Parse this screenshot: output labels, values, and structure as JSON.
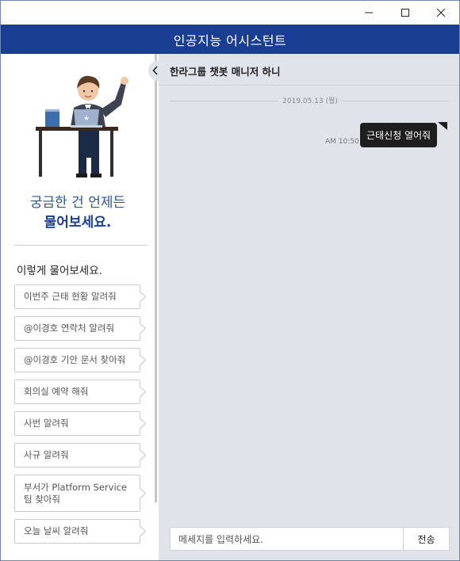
{
  "window": {
    "controls": [
      "minimize-icon",
      "maximize-icon",
      "close-icon"
    ]
  },
  "header": {
    "title": "인공지능 어시스턴트"
  },
  "sidebar": {
    "slogan_line1": "궁금한 건 언제든",
    "slogan_line2": "물어보세요.",
    "guide_title": "이렇게 물어보세요.",
    "suggestions": [
      "이번주 근태 현황 알려줘",
      "@이경호 연락처 알려줘",
      "@이경호 기안 문서 찾아줘",
      "회의실 예약 해줘",
      "사번 알려줘",
      "사규 알려줘",
      "부서가 Platform Service팀 찾아줘",
      "오늘 날씨 알려줘"
    ]
  },
  "chat": {
    "title": "한라그룹 챗봇 매니저 하니",
    "date": "2019.05.13 (월)",
    "messages": [
      {
        "time": "AM 10:50",
        "text": "근태신청 열어줘"
      }
    ],
    "input_placeholder": "메세지를 입력하세요.",
    "send_label": "전송"
  },
  "colors": {
    "header_bg": "#1a3f92",
    "slogan_color": "#2f5597",
    "chat_bg": "#e0e3e9",
    "bubble_bg": "#1e1e1e"
  }
}
